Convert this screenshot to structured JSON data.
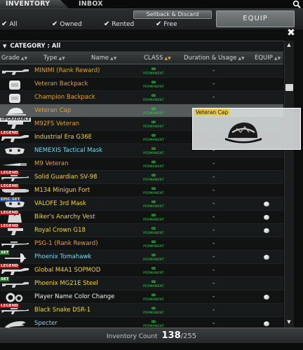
{
  "tabs": {
    "inventory": "INVENTORY",
    "inbox": "INBOX"
  },
  "toolbar": {
    "sellback_label": "Sellback & Discard",
    "equip_label": "EQUIP",
    "filters": [
      {
        "label": "All",
        "checked": true
      },
      {
        "label": "Owned",
        "checked": true
      },
      {
        "label": "Rented",
        "checked": true
      },
      {
        "label": "Free",
        "checked": true
      }
    ],
    "check_glyph": "✔"
  },
  "close_glyph": "✖",
  "category": {
    "label": "CATEGORY : All"
  },
  "columns": {
    "grade": "Grade",
    "type": "Type",
    "name": "Name",
    "class": "CLASS",
    "duration": "Duration & Usage",
    "equip": "EQUIP"
  },
  "permanent_label": "PERMANENT",
  "items": [
    {
      "name": "MINIMI (Rank Reward)",
      "color": "#e0a030",
      "icon": "machine-gun-icon",
      "badge": null,
      "duration": "-",
      "equipped": false,
      "selected": false
    },
    {
      "name": "Veteran Backpack",
      "color": "#e0a030",
      "icon": "backpack-icon",
      "badge": null,
      "duration": "-",
      "equipped": false,
      "selected": false
    },
    {
      "name": "Champion Backpack",
      "color": "#e0a030",
      "icon": "backpack-icon",
      "badge": null,
      "duration": "-",
      "equipped": false,
      "selected": false
    },
    {
      "name": "Veteran Cap",
      "color": "#e0a030",
      "icon": "cap-icon",
      "badge": null,
      "duration": "-",
      "equipped": false,
      "selected": true
    },
    {
      "name": "M92FS Veteran",
      "color": "#e0a030",
      "icon": "pistol-icon",
      "badge": "UPGRADABLE",
      "badge_style": "b-upg",
      "duration": "-",
      "equipped": false,
      "selected": false
    },
    {
      "name": "Industrial Era G36E",
      "color": "#f2d23a",
      "icon": "rifle-icon",
      "badge": "LEGEND",
      "badge_style": "b-red",
      "duration": "-",
      "equipped": false,
      "selected": false
    },
    {
      "name": "NEMEXIS Tactical Mask",
      "color": "#7fd4f2",
      "icon": "mask-icon",
      "badge": null,
      "duration": "-",
      "equipped": false,
      "selected": false
    },
    {
      "name": "M9 Veteran",
      "color": "#e0a030",
      "icon": "knife-icon",
      "badge": null,
      "duration": "-",
      "equipped": false,
      "selected": false
    },
    {
      "name": "Solid Guardian SV-98",
      "color": "#f2d23a",
      "icon": "sniper-icon",
      "badge": "LEGEND",
      "badge_style": "b-red",
      "duration": "-",
      "equipped": false,
      "selected": false
    },
    {
      "name": "M134 Minigun Fort",
      "color": "#f2d23a",
      "icon": "minigun-icon",
      "badge": "LEGEND",
      "badge_style": "b-red",
      "duration": "-",
      "equipped": false,
      "selected": false
    },
    {
      "name": "VALOFE 3rd Mask",
      "color": "#f2d23a",
      "icon": "mask-icon",
      "badge": "EPIC SET",
      "badge_style": "b-epic",
      "duration": "-",
      "equipped": true,
      "selected": false
    },
    {
      "name": "Biker's Anarchy Vest",
      "color": "#f2d23a",
      "icon": "vest-icon",
      "badge": "LEGEND",
      "badge_style": "b-red",
      "duration": "-",
      "equipped": true,
      "selected": false
    },
    {
      "name": "Royal Crown G18",
      "color": "#f2d23a",
      "icon": "pistol-icon",
      "badge": "LEGEND",
      "badge_style": "b-red",
      "duration": "-",
      "equipped": true,
      "selected": false
    },
    {
      "name": "PSG-1 (Rank Reward)",
      "color": "#e0a030",
      "icon": "sniper-icon",
      "badge": null,
      "duration": "-",
      "equipped": false,
      "selected": false
    },
    {
      "name": "Phoenix Tomahawk",
      "color": "#7fd4f2",
      "icon": "axe-icon",
      "badge": "SET",
      "badge_style": "b-set",
      "duration": "-",
      "equipped": true,
      "selected": false
    },
    {
      "name": "Global M4A1 SOPMOD",
      "color": "#f2d23a",
      "icon": "rifle-icon",
      "badge": "LEGEND",
      "badge_style": "b-red",
      "duration": "-",
      "equipped": false,
      "selected": false
    },
    {
      "name": "Phoenix MG21E Steel",
      "color": "#f2d23a",
      "icon": "machine-gun-icon",
      "badge": "SET",
      "badge_style": "b-set",
      "duration": "-",
      "equipped": false,
      "selected": false
    },
    {
      "name": "Player Name Color Change",
      "color": "#f0f0f0",
      "icon": "gear-icon",
      "badge": null,
      "duration": "-",
      "equipped": true,
      "selected": false
    },
    {
      "name": "Black Snake DSR-1",
      "color": "#f2d23a",
      "icon": "sniper-icon",
      "badge": "LEGEND",
      "badge_style": "b-red",
      "duration": "-",
      "equipped": false,
      "selected": false
    },
    {
      "name": "Specter",
      "color": "#7fd4f2",
      "icon": "glove-icon",
      "badge": null,
      "duration": "-",
      "equipped": true,
      "selected": false
    }
  ],
  "tooltip": {
    "title": "Veteran Cap",
    "icon": "cap-icon"
  },
  "scroll": {
    "up": "▲",
    "down": "▼"
  },
  "footer": {
    "label": "Inventory Count",
    "count": "138",
    "max": "/255"
  }
}
